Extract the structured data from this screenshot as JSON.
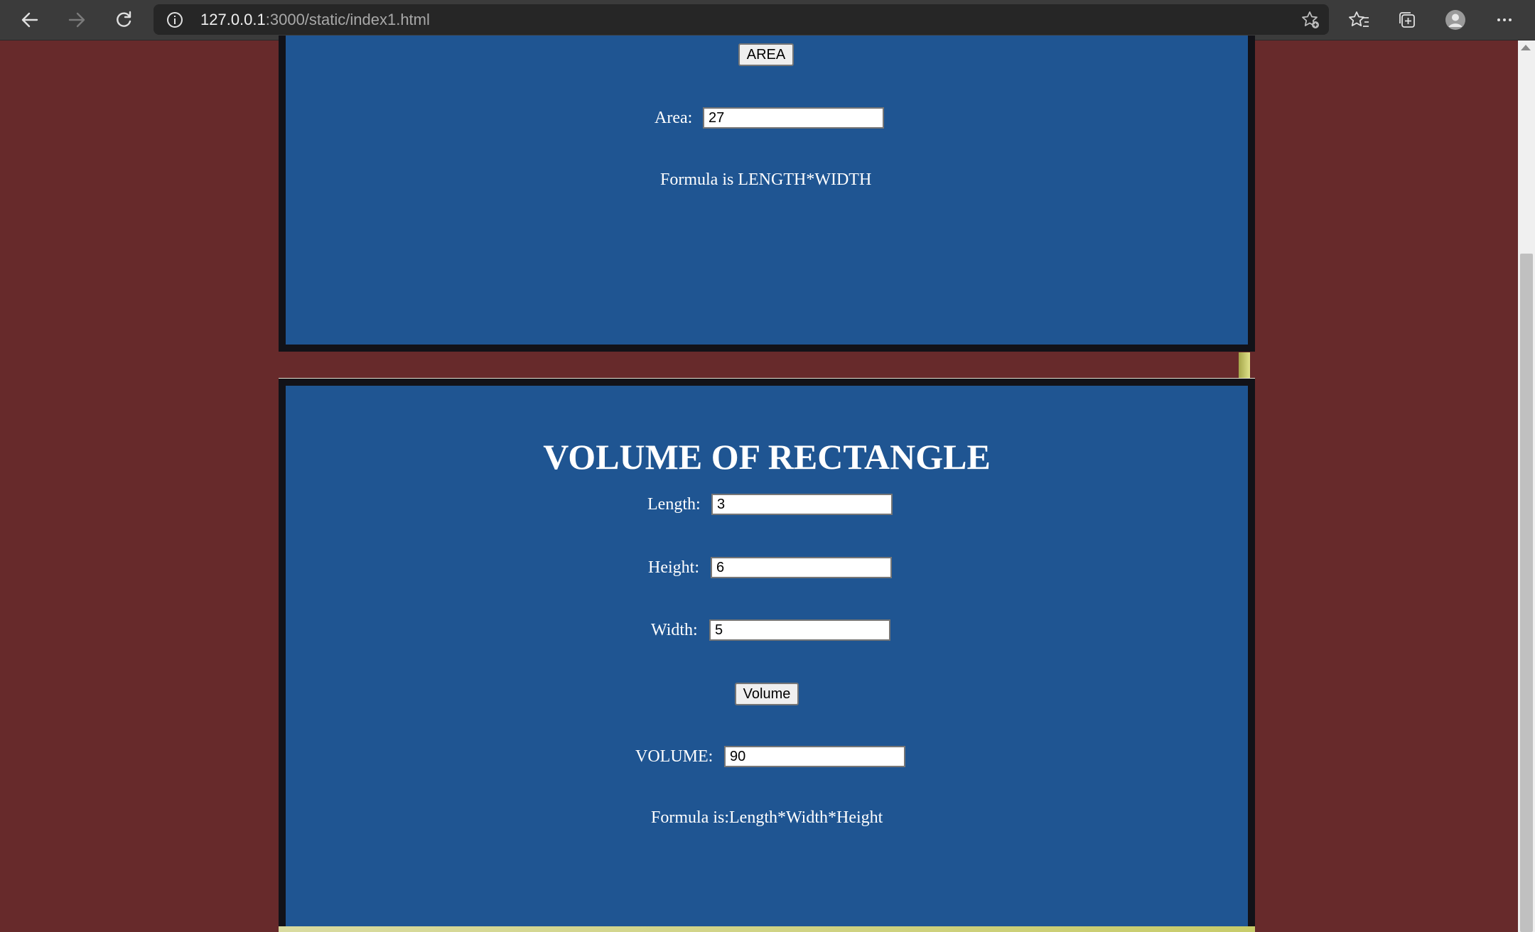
{
  "browser": {
    "url_host": "127.0.0.1",
    "url_path": ":3000/static/index1.html"
  },
  "area_section": {
    "button_label": "AREA",
    "result_label": "Area:",
    "result_value": "27",
    "formula": "Formula is LENGTH*WIDTH"
  },
  "volume_section": {
    "title": "VOLUME OF RECTANGLE",
    "length_label": "Length:",
    "length_value": "3",
    "height_label": "Height:",
    "height_value": "6",
    "width_label": "Width:",
    "width_value": "5",
    "button_label": "Volume",
    "result_label": "VOLUME:",
    "result_value": "90",
    "formula": "Formula is:Length*Width*Height"
  },
  "colors": {
    "page_background": "#672a2b",
    "panel_background": "#1f5592",
    "panel_border": "#121218",
    "browser_chrome": "#3b3b3b"
  }
}
